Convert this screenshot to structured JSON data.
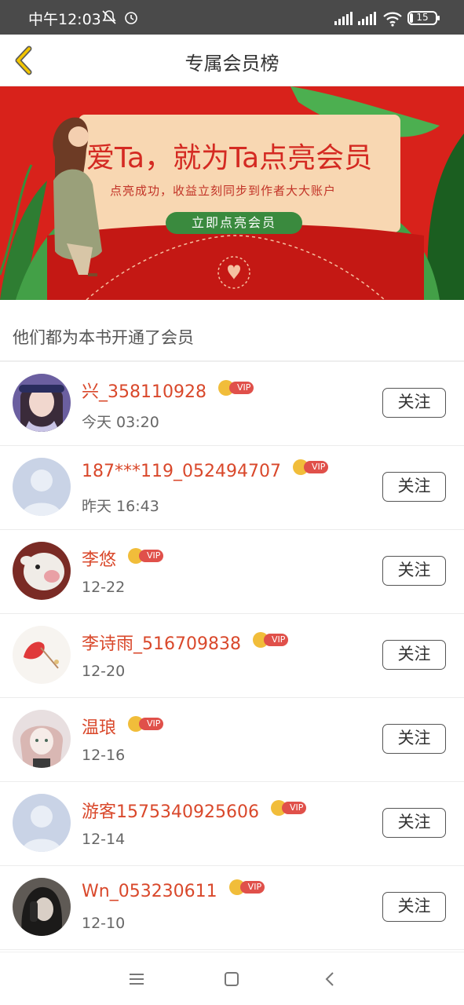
{
  "status_bar": {
    "time": "中午12:03",
    "battery_level": "15",
    "icons": [
      "mute-icon",
      "alarm-icon",
      "signal-icon",
      "signal-icon",
      "wifi-icon",
      "battery-icon"
    ]
  },
  "header": {
    "title": "专属会员榜",
    "back_icon": "chevron-left-icon"
  },
  "banner": {
    "headline": "爱Ta，就为Ta点亮会员",
    "subtitle": "点亮成功，收益立刻同步到作者大大账户",
    "cta": "立即点亮会员"
  },
  "section": {
    "heading": "他们都为本书开通了会员"
  },
  "members": [
    {
      "name": "兴_358110928",
      "badge": "VIP",
      "date": "今天 03:20",
      "follow": "关注",
      "avatar": "photo"
    },
    {
      "name": "187***119_052494707",
      "badge": "VIP",
      "date": "昨天 16:43",
      "follow": "关注",
      "avatar": "default"
    },
    {
      "name": "李悠",
      "badge": "VIP",
      "date": "12-22",
      "follow": "关注",
      "avatar": "photo"
    },
    {
      "name": "李诗雨_516709838",
      "badge": "VIP",
      "date": "12-20",
      "follow": "关注",
      "avatar": "photo"
    },
    {
      "name": "温琅",
      "badge": "VIP",
      "date": "12-16",
      "follow": "关注",
      "avatar": "photo"
    },
    {
      "name": "游客1575340925606",
      "badge": "VIP",
      "date": "12-14",
      "follow": "关注",
      "avatar": "default"
    },
    {
      "name": "Wn_053230611",
      "badge": "VIP",
      "date": "12-10",
      "follow": "关注",
      "avatar": "photo"
    }
  ],
  "navbar": {
    "icons": [
      "menu-icon",
      "home-icon",
      "back-icon"
    ]
  },
  "colors": {
    "accent": "#d9482b",
    "banner_red": "#d8221b",
    "vip_red": "#e0504a",
    "crown_gold": "#f1bd3a",
    "header_back": "#e8b800"
  }
}
